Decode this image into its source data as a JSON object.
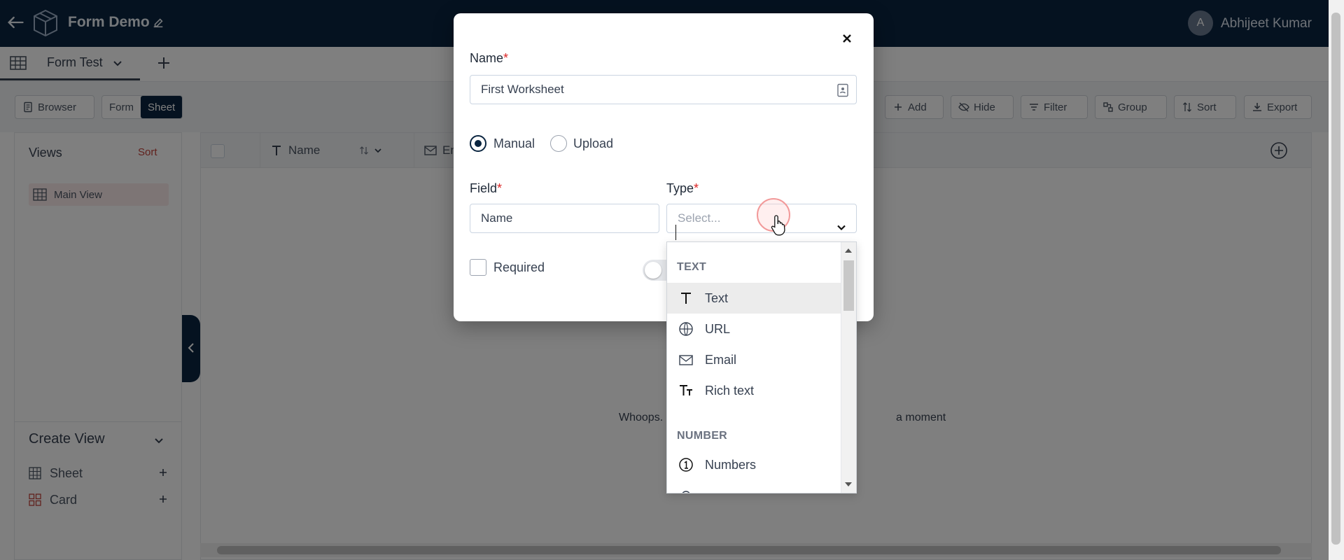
{
  "app": {
    "title": "Form Demo",
    "user_initial": "A",
    "user_name": "Abhijeet Kumar"
  },
  "tabs": [
    {
      "label": "Form Test"
    }
  ],
  "toolbar": {
    "browser": "Browser",
    "form": "Form",
    "sheet": "Sheet",
    "add": "Add",
    "hide": "Hide",
    "filter": "Filter",
    "group": "Group",
    "sort": "Sort",
    "export": "Export"
  },
  "views": {
    "title": "Views",
    "sort": "Sort",
    "main_view": "Main View",
    "create_title": "Create View",
    "create_items": [
      {
        "label": "Sheet"
      },
      {
        "label": "Card"
      }
    ]
  },
  "grid": {
    "columns": [
      {
        "label": "Name"
      },
      {
        "label": "Ema"
      }
    ],
    "message_left": "Whoops.",
    "message_right": "a moment"
  },
  "modal": {
    "name_label": "Name",
    "name_value": "First Worksheet",
    "mode_manual": "Manual",
    "mode_upload": "Upload",
    "field_label": "Field",
    "field_value": "Name",
    "type_label": "Type",
    "type_placeholder": "Select...",
    "required_label": "Required",
    "required_marker": "*"
  },
  "dropdown": {
    "groups": [
      {
        "name": "TEXT",
        "options": [
          {
            "label": "Text",
            "icon": "text-icon"
          },
          {
            "label": "URL",
            "icon": "globe-icon"
          },
          {
            "label": "Email",
            "icon": "mail-icon"
          },
          {
            "label": "Rich text",
            "icon": "rich-text-icon"
          }
        ]
      },
      {
        "name": "NUMBER",
        "options": [
          {
            "label": "Numbers",
            "icon": "number-circle-icon"
          }
        ]
      }
    ],
    "highlighted": "Text"
  },
  "colors": {
    "brand": "#0a2540",
    "accent_red": "#c2423a",
    "required": "#dc2626"
  }
}
